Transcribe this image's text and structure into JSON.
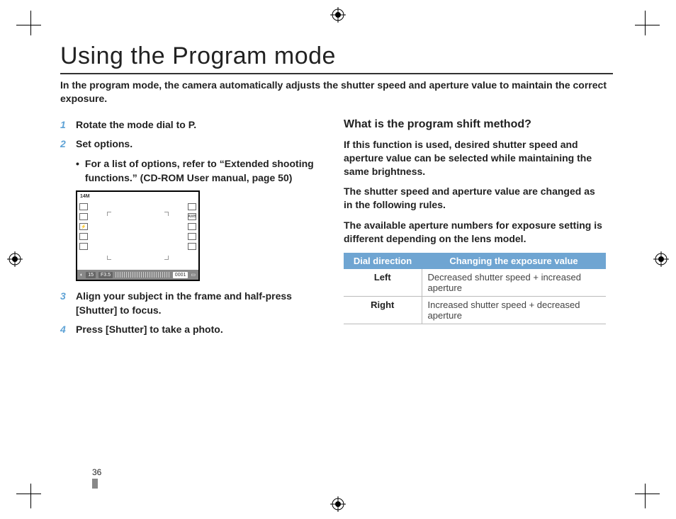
{
  "title": "Using the Program mode",
  "intro": "In the program mode, the camera automatically adjusts the shutter speed and aperture value to maintain the correct exposure.",
  "steps": {
    "s1": {
      "num": "1",
      "text_a": "Rotate the mode dial to ",
      "text_b": "P",
      "text_c": "."
    },
    "s2": {
      "num": "2",
      "text": "Set options."
    },
    "s2_sub": {
      "bullet": "•",
      "text": "For a list of options, refer to “Extended shooting functions.” (CD-ROM User manual, page 50)"
    },
    "s3": {
      "num": "3",
      "text_a": "Align your subject in the frame and half-press ",
      "text_b": "[Shutter]",
      "text_c": " to focus."
    },
    "s4": {
      "num": "4",
      "text_a": "Press ",
      "text_b": "[Shutter]",
      "text_c": " to take a photo."
    }
  },
  "camera": {
    "top_label": "14M",
    "awb": "AWB",
    "shutter": "15",
    "aperture": "F3.5",
    "counter": "0001"
  },
  "right": {
    "heading": "What is the program shift method?",
    "p1": "If this function is used, desired shutter speed and aperture value can be selected while maintaining the same brightness.",
    "p2": "The shutter speed and aperture value are changed as in the following rules.",
    "p3": "The available aperture numbers for exposure setting is different depending on the lens model."
  },
  "table": {
    "head": {
      "c1": "Dial direction",
      "c2": "Changing the exposure value"
    },
    "rows": [
      {
        "dir": "Left",
        "val": "Decreased shutter speed + increased aperture"
      },
      {
        "dir": "Right",
        "val": "Increased shutter speed + decreased aperture"
      }
    ]
  },
  "page_number": "36"
}
